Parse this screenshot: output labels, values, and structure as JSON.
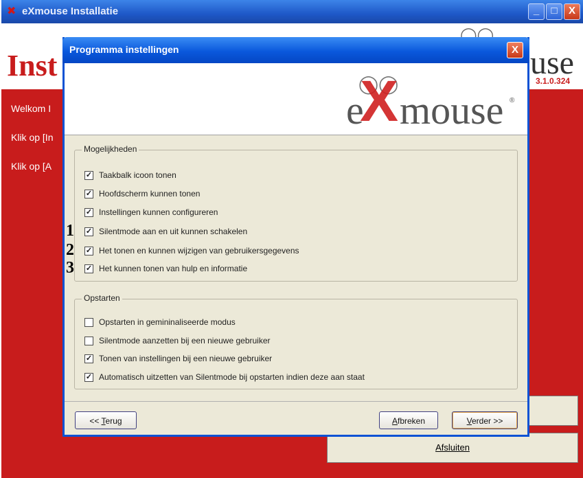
{
  "background_window": {
    "title": "eXmouse Installatie",
    "controls": {
      "minimize": "_",
      "maximize": "□",
      "close": "X"
    },
    "header_title": "Inst",
    "logo_partial": "use",
    "version": "3.1.0.324",
    "lines": [
      "Welkom I",
      "Klik op [In",
      "Klik op [A"
    ],
    "buttons": {
      "close_label": "Afsluiten"
    }
  },
  "dialog": {
    "title": "Programma instellingen",
    "close_glyph": "X",
    "logo": {
      "e": "e",
      "x": "X",
      "rest": "mouse",
      "reg": "®"
    },
    "groups": [
      {
        "legend": "Mogelijkheden",
        "items": [
          {
            "label": "Taakbalk icoon tonen",
            "checked": true,
            "marker": ""
          },
          {
            "label": "Hoofdscherm kunnen tonen",
            "checked": true,
            "marker": ""
          },
          {
            "label": "Instellingen kunnen configureren",
            "checked": true,
            "marker": ""
          },
          {
            "label": "Silentmode aan en uit kunnen schakelen",
            "checked": true,
            "marker": "1"
          },
          {
            "label": "Het tonen en kunnen wijzigen van gebruikersgegevens",
            "checked": true,
            "marker": "2"
          },
          {
            "label": "Het kunnen tonen van hulp en informatie",
            "checked": true,
            "marker": "3"
          }
        ]
      },
      {
        "legend": "Opstarten",
        "items": [
          {
            "label": "Opstarten in gemininaliseerde modus",
            "checked": false
          },
          {
            "label": "Silentmode aanzetten bij een nieuwe gebruiker",
            "checked": false
          },
          {
            "label": "Tonen van instellingen bij een nieuwe gebruiker",
            "checked": true
          },
          {
            "label": "Automatisch uitzetten van Silentmode bij opstarten indien deze aan staat",
            "checked": true
          }
        ]
      }
    ],
    "buttons": {
      "back": {
        "prefix": "<< ",
        "accel": "T",
        "rest": "erug"
      },
      "cancel": {
        "accel": "A",
        "rest": "fbreken"
      },
      "next": {
        "accel": "V",
        "rest": "erder >>"
      }
    }
  },
  "colors": {
    "accent_red": "#c81c1c",
    "titlebar_blue": "#0a58dc",
    "dialog_bg": "#ece9d8"
  },
  "icons": {
    "app": "mouse-app-icon",
    "check": "checkmark-icon"
  }
}
